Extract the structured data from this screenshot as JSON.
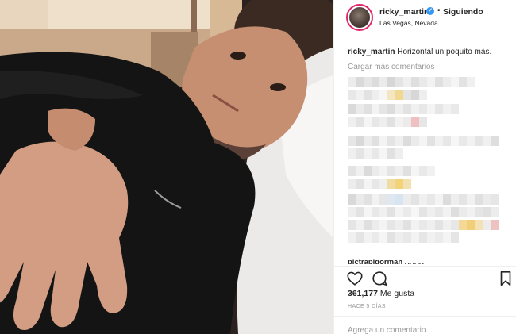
{
  "post": {
    "author": {
      "username": "ricky_martin",
      "verified": true,
      "separator": "•",
      "follow_status": "Siguiendo",
      "location": "Las Vegas, Nevada"
    },
    "caption": {
      "username": "ricky_martin",
      "text": "Horizontal un poquito más."
    },
    "load_more_label": "Cargar más comentarios",
    "partial_comment_user": "pictrapigorman ␣␣␣␣",
    "likes": {
      "count": "361,177",
      "label": "Me gusta"
    },
    "timestamp": "HACE 5 DÍAS",
    "add_comment_placeholder": "Agrega un comentario..."
  },
  "icons": {
    "like": "heart-outline-icon",
    "comment": "speech-bubble-icon",
    "save": "bookmark-icon",
    "verified": "verified-badge-icon"
  },
  "colors": {
    "story_ring": "#e0266b",
    "verified": "#3897f0",
    "muted_text": "#999999",
    "primary_text": "#262626"
  }
}
